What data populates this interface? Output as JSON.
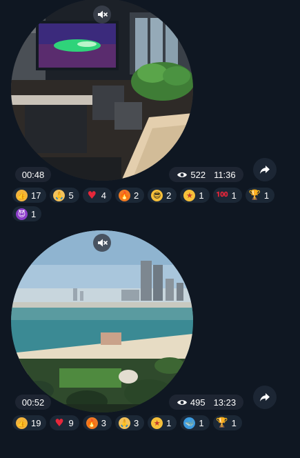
{
  "messages": [
    {
      "duration": "00:48",
      "views": "522",
      "time": "11:36",
      "reactions": [
        {
          "icon": "thumbs-up",
          "count": "17"
        },
        {
          "icon": "folded-hands",
          "count": "5"
        },
        {
          "icon": "red-heart",
          "count": "4"
        },
        {
          "icon": "fire",
          "count": "2"
        },
        {
          "icon": "sunglasses-face",
          "count": "2"
        },
        {
          "icon": "star-struck-face",
          "count": "1"
        },
        {
          "icon": "hundred-points",
          "count": "1"
        },
        {
          "icon": "trophy",
          "count": "1"
        },
        {
          "icon": "smiling-devil",
          "count": "1"
        }
      ]
    },
    {
      "duration": "00:52",
      "views": "495",
      "time": "13:23",
      "reactions": [
        {
          "icon": "thumbs-up",
          "count": "19"
        },
        {
          "icon": "red-heart",
          "count": "9"
        },
        {
          "icon": "fire",
          "count": "3"
        },
        {
          "icon": "folded-hands",
          "count": "3"
        },
        {
          "icon": "star-struck-face",
          "count": "1"
        },
        {
          "icon": "whale",
          "count": "1"
        },
        {
          "icon": "trophy",
          "count": "1"
        }
      ]
    }
  ],
  "colors": {
    "background": "#0f1722",
    "pill": "#1f2734",
    "chip": "#1c2836"
  }
}
